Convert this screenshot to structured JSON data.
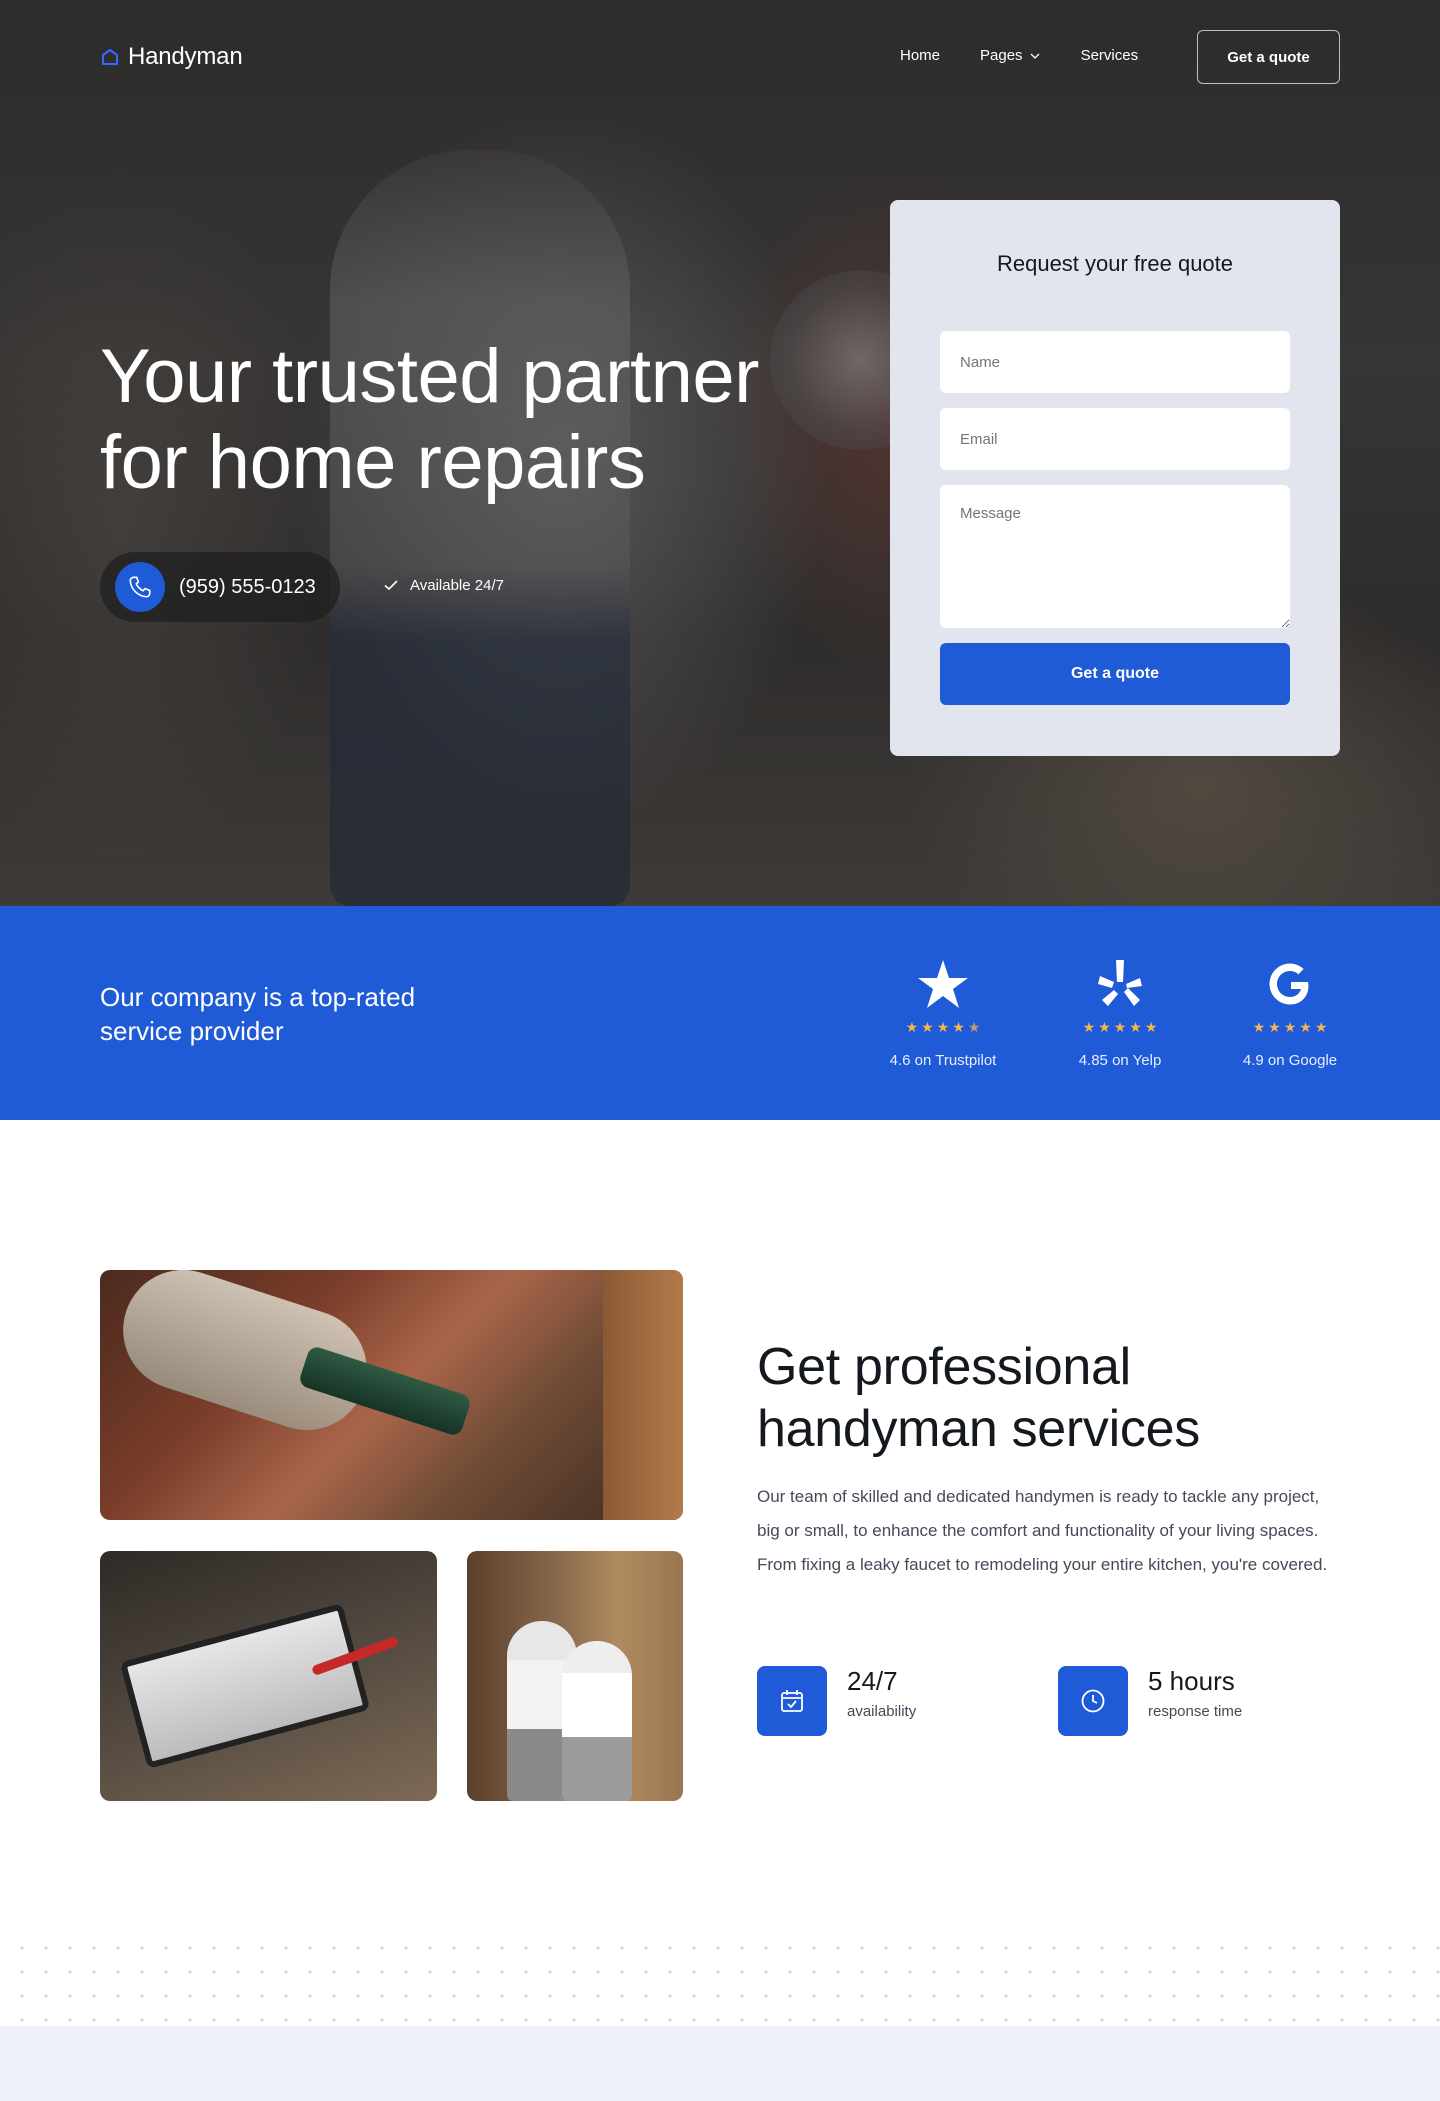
{
  "nav": {
    "logo_text": "Handyman",
    "links": [
      {
        "label": "Home"
      },
      {
        "label": "Pages"
      },
      {
        "label": "Services"
      }
    ],
    "cta_label": "Get a quote"
  },
  "hero": {
    "title": "Your trusted partner for home repairs",
    "phone": "(959) 555-0123",
    "availability": "Available 24/7"
  },
  "quote_form": {
    "title": "Request your free quote",
    "name_placeholder": "Name",
    "email_placeholder": "Email",
    "message_placeholder": "Message",
    "submit_label": "Get a quote"
  },
  "ratings_band": {
    "heading": "Our company is a top-rated service provider",
    "ratings": [
      {
        "brand": "trustpilot-icon",
        "stars": 4.5,
        "label": "4.6 on Trustpilot"
      },
      {
        "brand": "yelp-icon",
        "stars": 5,
        "label": "4.85 on Yelp"
      },
      {
        "brand": "google-icon",
        "stars": 5,
        "label": "4.9 on Google"
      }
    ]
  },
  "services": {
    "title": "Get professional handyman services",
    "body": "Our team of skilled and dedicated handymen is ready to tackle any project, big or small, to enhance the comfort and functionality of your living spaces. From fixing a leaky faucet to remodeling your entire kitchen, you're covered.",
    "stats": [
      {
        "icon": "calendar-check-icon",
        "value": "24/7",
        "label": "availability"
      },
      {
        "icon": "clock-icon",
        "value": "5 hours",
        "label": "response time"
      }
    ]
  },
  "colors": {
    "accent": "#1f5bd6",
    "star": "#f6b64a",
    "card_bg": "#e2e5ee",
    "footer_bg": "#eef1f9"
  }
}
